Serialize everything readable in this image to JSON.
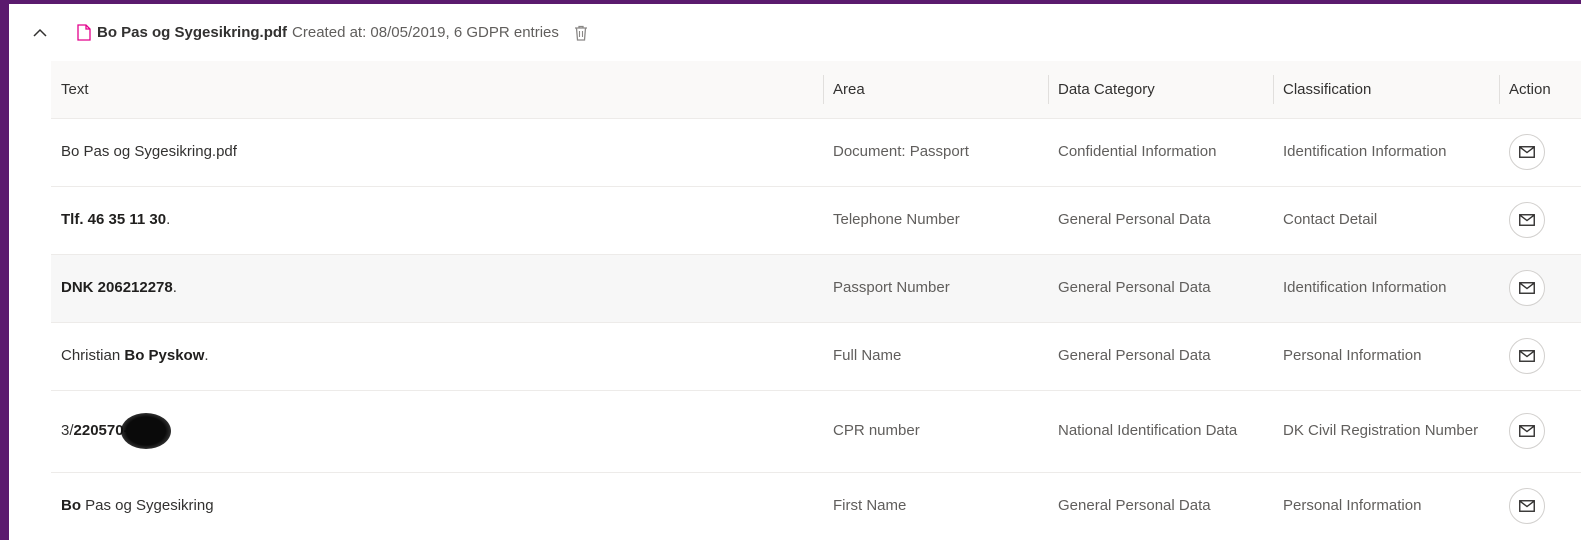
{
  "file": {
    "name": "Bo Pas og Sygesikring.pdf",
    "meta": "Created at: 08/05/2019, 6 GDPR entries"
  },
  "table": {
    "columns": [
      "Text",
      "Area",
      "Data Category",
      "Classification",
      "Action"
    ],
    "rows": [
      {
        "text_parts": [
          {
            "t": "Bo Pas og Sygesikring.pdf",
            "b": false
          }
        ],
        "area": "Document: Passport",
        "category": "Confidential Information",
        "classification": "Identification Information",
        "height": 68
      },
      {
        "text_parts": [
          {
            "t": "Tlf. 46 35 11 30",
            "b": true
          },
          {
            "t": ".",
            "b": false
          }
        ],
        "area": "Telephone Number",
        "category": "General Personal Data",
        "classification": "Contact Detail",
        "height": 68
      },
      {
        "text_parts": [
          {
            "t": "DNK 206212278",
            "b": true
          },
          {
            "t": ".",
            "b": false
          }
        ],
        "area": "Passport Number",
        "category": "General Personal Data",
        "classification": "Identification Information",
        "height": 68,
        "shaded": true
      },
      {
        "text_parts": [
          {
            "t": "Christian ",
            "b": false
          },
          {
            "t": "Bo Pyskow",
            "b": true
          },
          {
            "t": ".",
            "b": false
          }
        ],
        "area": "Full Name",
        "category": "General Personal Data",
        "classification": "Personal Information",
        "height": 68
      },
      {
        "text_parts": [
          {
            "t": "3/",
            "b": false
          },
          {
            "t": "220570-",
            "b": true
          }
        ],
        "redacted": true,
        "area": "CPR number",
        "category": "National Identification Data",
        "classification": "DK Civil Registration Number",
        "height": 82
      },
      {
        "text_parts": [
          {
            "t": "Bo",
            "b": true
          },
          {
            "t": " Pas og Sygesikring",
            "b": false
          }
        ],
        "area": "First Name",
        "category": "General Personal Data",
        "classification": "Personal Information",
        "height": 68
      }
    ]
  },
  "icons": {
    "collapse": "chevron-up-icon",
    "file": "pdf-file-icon",
    "delete": "trash-icon",
    "action": "mail-icon"
  },
  "colors": {
    "background": "#5b1a6e",
    "file_icon": "#e3008c",
    "row_shaded": "#f7f7f7"
  }
}
